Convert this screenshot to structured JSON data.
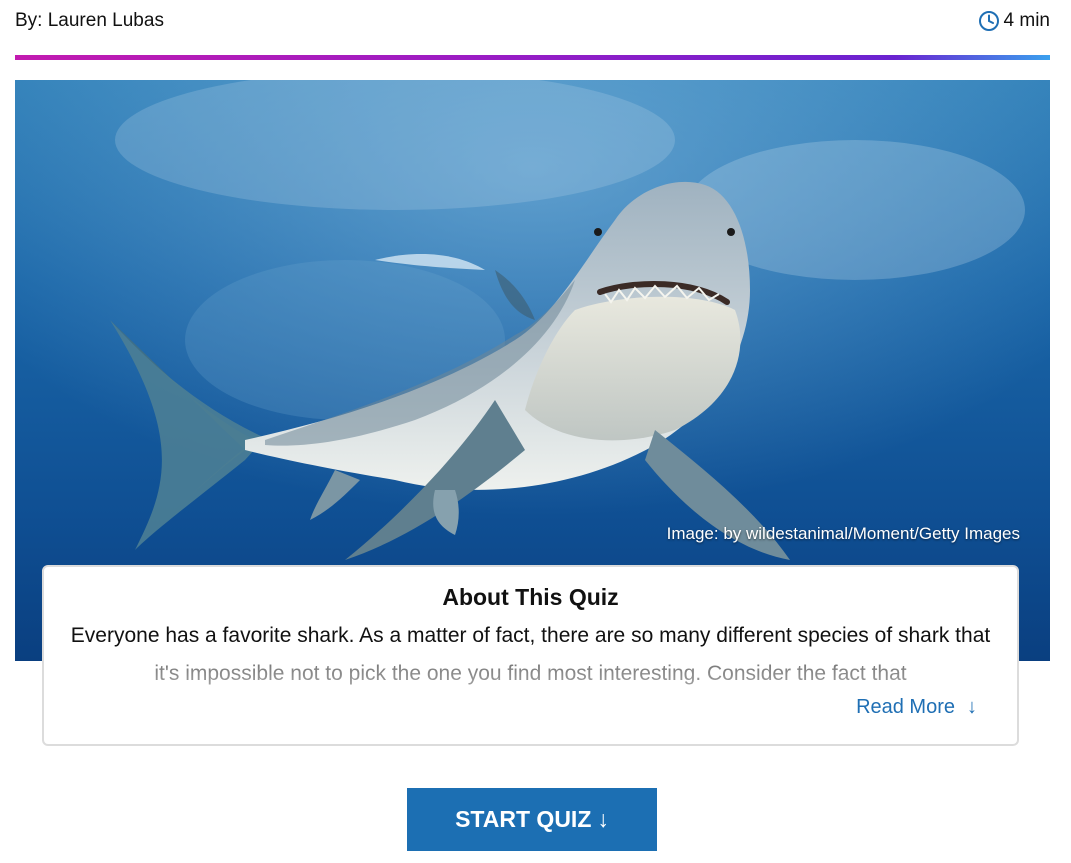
{
  "meta": {
    "author": "By: Lauren Lubas",
    "read_time": "4 min",
    "clock_icon": "clock-icon"
  },
  "colors": {
    "accent_gradient": [
      "#c21bb0",
      "#9a1cc4",
      "#6a22d0",
      "#3aa0ee"
    ],
    "button_blue": "#1c6fb3",
    "link_blue": "#1f6fb4"
  },
  "hero": {
    "image_credit": "Image: by wildestanimal/Moment/Getty Images"
  },
  "about": {
    "title": "About This Quiz",
    "body": "Everyone has a favorite shark. As a matter of fact, there are so many different species of shark that it's impossible not to pick the one you find most interesting. Consider the fact that",
    "read_more_label": "Read More",
    "read_more_icon": "↓"
  },
  "cta": {
    "start_label": "START QUIZ",
    "start_icon": "↓"
  }
}
